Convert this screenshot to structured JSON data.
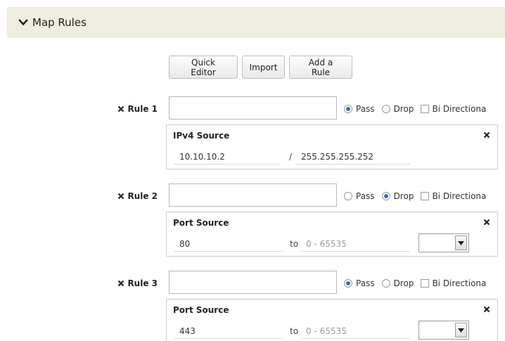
{
  "section": {
    "title": "Map Rules",
    "icon": "chevron-down-icon"
  },
  "toolbar": {
    "quick_editor": "Quick Editor",
    "import": "Import",
    "add_rule": "Add a Rule"
  },
  "options": {
    "pass": "Pass",
    "drop": "Drop",
    "bidirectional": "Bi Directiona"
  },
  "rules": [
    {
      "label": "Rule 1",
      "name_value": "",
      "action": "Pass",
      "bidirectional": false,
      "filter": {
        "title": "IPv4 Source",
        "value1": "10.10.10.2",
        "separator": "/",
        "value2": "255.255.255.252"
      }
    },
    {
      "label": "Rule 2",
      "name_value": "",
      "action": "Drop",
      "bidirectional": false,
      "filter": {
        "title": "Port Source",
        "value1": "80",
        "separator": "to",
        "value2_placeholder": "0 - 65535",
        "select_value": ""
      }
    },
    {
      "label": "Rule 3",
      "name_value": "",
      "action": "Pass",
      "bidirectional": false,
      "filter": {
        "title": "Port Source",
        "value1": "443",
        "separator": "to",
        "value2_placeholder": "0 - 65535",
        "select_value": ""
      }
    }
  ],
  "colors": {
    "header_bg": "#efeddf",
    "radio_checked": "#3c6bbf"
  }
}
